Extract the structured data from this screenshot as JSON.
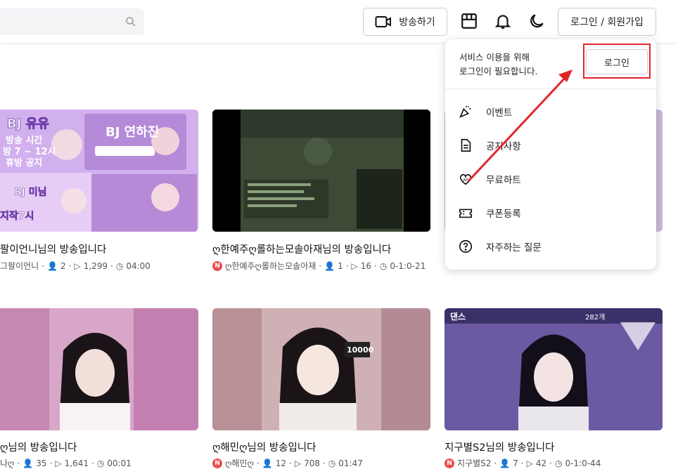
{
  "header": {
    "search_placeholder": "",
    "broadcast_label": "방송하기",
    "login_signup_label": "로그인 / 회원가입"
  },
  "dropdown": {
    "message_line1": "서비스 이용을 위해",
    "message_line2": "로그인이 필요합니다.",
    "login_button": "로그인",
    "items": [
      {
        "label": "이벤트",
        "icon": "party-popper-icon"
      },
      {
        "label": "공지사항",
        "icon": "document-icon"
      },
      {
        "label": "무료하트",
        "icon": "heart-ad-icon"
      },
      {
        "label": "쿠폰등록",
        "icon": "coupon-icon"
      },
      {
        "label": "자주하는 질문",
        "icon": "question-icon"
      }
    ]
  },
  "cards": [
    {
      "title": "팔이언니님의 방송입니다",
      "channel": "그팔이언니",
      "viewers": "2",
      "plays": "1,299",
      "duration": "04:00",
      "badge": false
    },
    {
      "title": "ღ한예주ღ롤하는모솔아재님의 방송입니다",
      "channel": "ღ한예주ღ롤하는모솔아재",
      "viewers": "1",
      "plays": "16",
      "duration": "0-1:0-21",
      "badge": true
    },
    {
      "title": "ღ님의 방송입니다",
      "channel": "나ღ",
      "viewers": "35",
      "plays": "1,641",
      "duration": "00:01",
      "badge": false
    },
    {
      "title": "ღ해민ღ님의 방송입니다",
      "channel": "ღ해민ღ",
      "viewers": "12",
      "plays": "708",
      "duration": "01:47",
      "badge": true
    },
    {
      "title": "지구별S2님의 방송입니다",
      "channel": "지구별S2",
      "viewers": "7",
      "plays": "42",
      "duration": "0-1:0-44",
      "badge": true
    }
  ],
  "thumb_text": {
    "bj_yuyu": "BJ 유유",
    "time_line1": "방송 시간",
    "time_line2": "밤 7 ~ 12시",
    "time_line3": "휴방 공지",
    "bj_yeonhajin": "BJ 연하진",
    "bj_mimi": "BJ 미님",
    "start7": "지작7시",
    "dance": "댄스",
    "live_count": "282개",
    "num_10000": "10000"
  },
  "colors": {
    "accent_red": "#e0262b",
    "badge_red": "#e94f4f",
    "purple": "#b88be0"
  }
}
